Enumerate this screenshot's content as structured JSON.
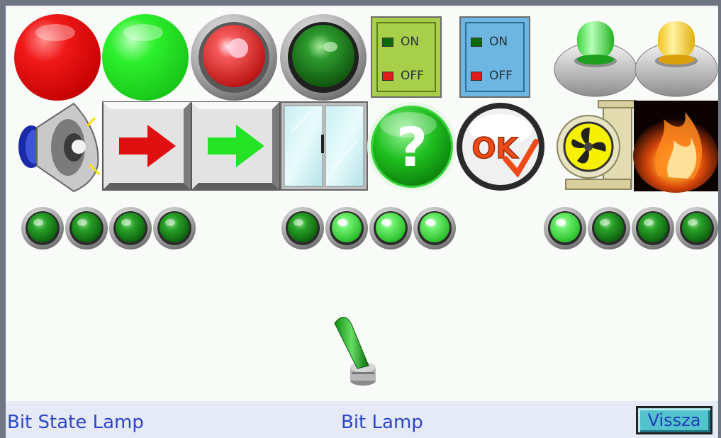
{
  "screen": {
    "title": "Bit State Lamp",
    "subtitle": "Bit Lamp"
  },
  "switches": [
    {
      "on_label": "ON",
      "off_label": "OFF",
      "color": "#a8cf4a",
      "border": "#5d7e18"
    },
    {
      "on_label": "ON",
      "off_label": "OFF",
      "color": "#6cb6e1",
      "border": "#2e6e99"
    }
  ],
  "nav": {
    "back_label": "Vissza"
  },
  "lamp_groups": [
    {
      "states": [
        "off",
        "off",
        "off",
        "off"
      ]
    },
    {
      "states": [
        "off",
        "on",
        "on",
        "on"
      ]
    },
    {
      "states": [
        "on",
        "off",
        "off",
        "off"
      ]
    }
  ],
  "icons": [
    "red-lamp-icon",
    "green-lamp-icon",
    "red-pilot-lamp-icon",
    "green-pilot-lamp-icon",
    "green-beacon-icon",
    "yellow-beacon-icon",
    "speaker-icon",
    "red-arrow-icon",
    "green-arrow-icon",
    "sliding-door-icon",
    "help-icon",
    "ok-icon",
    "fan-icon",
    "fire-icon",
    "toggle-lever-icon"
  ],
  "colors": {
    "text_blue": "#2b47c8",
    "lamp_on": "#6ef06e",
    "lamp_off": "#1f9a1f"
  }
}
